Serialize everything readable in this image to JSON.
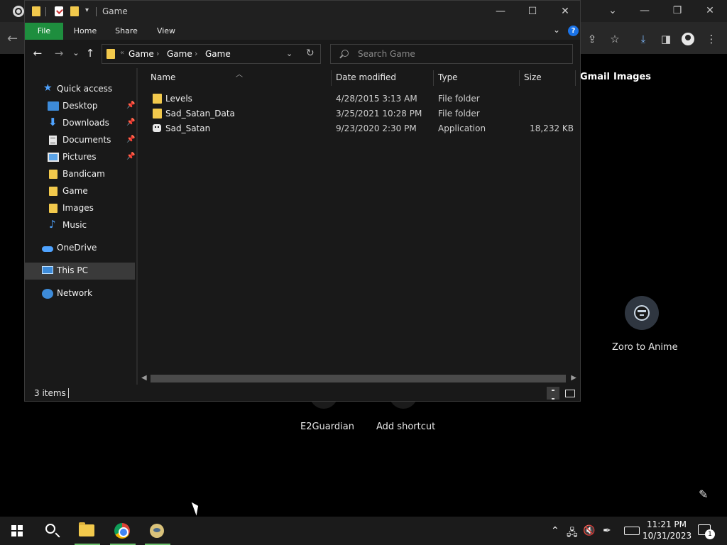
{
  "explorer": {
    "window_title": "Game",
    "ribbon_tabs": [
      "File",
      "Home",
      "Share",
      "View"
    ],
    "address": {
      "crumbs": [
        "Game",
        "Game",
        "Game"
      ]
    },
    "search": {
      "placeholder": "Search Game"
    },
    "sidebar": {
      "items": [
        {
          "label": "Quick access",
          "icon": "star-icon",
          "pinned": false
        },
        {
          "label": "Desktop",
          "icon": "desktop-icon",
          "pinned": true
        },
        {
          "label": "Downloads",
          "icon": "download-icon",
          "pinned": true
        },
        {
          "label": "Documents",
          "icon": "documents-icon",
          "pinned": true
        },
        {
          "label": "Pictures",
          "icon": "pictures-icon",
          "pinned": true
        },
        {
          "label": "Bandicam",
          "icon": "folder-icon",
          "pinned": false
        },
        {
          "label": "Game",
          "icon": "folder-icon",
          "pinned": false
        },
        {
          "label": "Images",
          "icon": "folder-icon",
          "pinned": false
        },
        {
          "label": "Music",
          "icon": "music-icon",
          "pinned": false
        },
        {
          "label": "OneDrive",
          "icon": "cloud-icon",
          "pinned": false
        },
        {
          "label": "This PC",
          "icon": "computer-icon",
          "pinned": false,
          "selected": true
        },
        {
          "label": "Network",
          "icon": "network-icon",
          "pinned": false
        }
      ]
    },
    "columns": {
      "name": "Name",
      "date": "Date modified",
      "type": "Type",
      "size": "Size"
    },
    "files": [
      {
        "name": "Levels",
        "date": "4/28/2015 3:13 AM",
        "type": "File folder",
        "size": "",
        "icon": "folder-icon"
      },
      {
        "name": "Sad_Satan_Data",
        "date": "3/25/2021 10:28 PM",
        "type": "File folder",
        "size": "",
        "icon": "folder-icon"
      },
      {
        "name": "Sad_Satan",
        "date": "9/23/2020 2:30 PM",
        "type": "Application",
        "size": "18,232 KB",
        "icon": "application-icon"
      }
    ],
    "status": {
      "item_count": "3 items"
    }
  },
  "browser_ntp": {
    "links": [
      "Gmail",
      "Images"
    ],
    "shortcuts": [
      "Zoro to Anime",
      "E2Guardian",
      "Add shortcut"
    ]
  },
  "taskbar": {
    "clock_time": "11:21 PM",
    "clock_date": "10/31/2023",
    "notification_count": "1"
  },
  "colors": {
    "file_tab_accent": "#1e8e3e",
    "folder": "#f2c94c",
    "link_blue": "#4fa3ff"
  }
}
